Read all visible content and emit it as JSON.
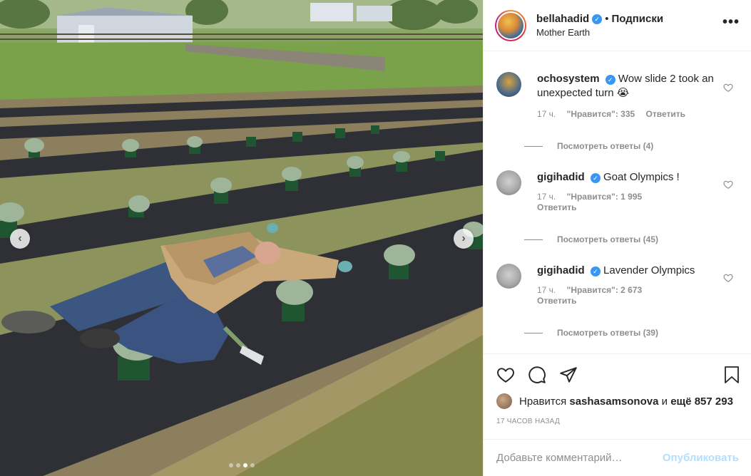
{
  "post": {
    "image_alt": "",
    "carousel": {
      "dots": 4,
      "active_dot": 2
    }
  },
  "header": {
    "username": "bellahadid",
    "verified": true,
    "separator": "•",
    "follow_label": "Подписки",
    "location": "Mother Earth",
    "more_label": "•••"
  },
  "comments": [
    {
      "username": "ochosystem",
      "verified": true,
      "text": "Wow slide 2 took an unexpected turn 😭",
      "time": "17 ч.",
      "likes": "\"Нравится\": 335",
      "reply": "Ответить",
      "view_replies": "Посмотреть ответы (4)"
    },
    {
      "username": "gigihadid",
      "verified": true,
      "text": "Goat Olympics !",
      "time": "17 ч.",
      "likes": "\"Нравится\": 1 995",
      "reply": "Ответить",
      "view_replies": "Посмотреть ответы (45)"
    },
    {
      "username": "gigihadid",
      "verified": true,
      "text": "Lavender Olympics",
      "time": "17 ч.",
      "likes": "\"Нравится\": 2 673",
      "reply": "Ответить",
      "view_replies": "Посмотреть ответы (39)"
    }
  ],
  "likes_line": {
    "prefix": "Нравится",
    "user": "sashasamsonova",
    "middle": "и",
    "count": "ещё 857 293"
  },
  "time_ago": "17 ЧАСОВ НАЗАД",
  "comment_input": {
    "placeholder": "Добавьте комментарий…",
    "publish_label": "Опубликовать"
  },
  "colors": {
    "accent_blue": "#3897f0",
    "publish_disabled": "#b2dffc",
    "muted_text": "#8e8e8e"
  },
  "icons": [
    "heart-icon",
    "comment-icon",
    "share-icon",
    "bookmark-icon",
    "verified-icon",
    "more-icon",
    "chevron-left-icon",
    "chevron-right-icon"
  ]
}
